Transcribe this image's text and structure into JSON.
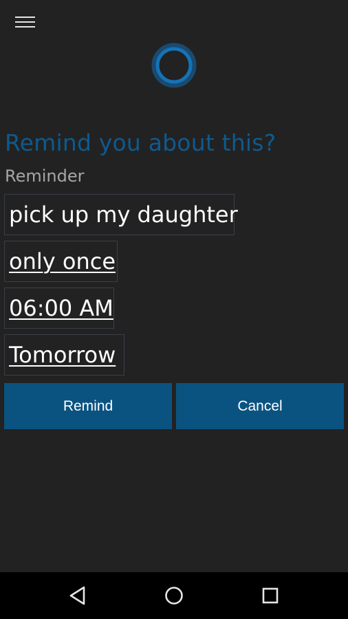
{
  "app": {
    "prompt": "Remind you about this?",
    "field_label": "Reminder"
  },
  "reminder": {
    "subject": "pick up my daughter",
    "frequency": "only once",
    "time": "06:00 AM",
    "day": "Tomorrow"
  },
  "actions": {
    "remind_label": "Remind",
    "cancel_label": "Cancel"
  },
  "icons": {
    "menu": "hamburger-menu-icon",
    "assistant": "cortana-ring-icon",
    "back": "back-triangle-icon",
    "home": "home-circle-icon",
    "recents": "recents-square-icon"
  },
  "colors": {
    "background": "#222222",
    "accent": "#0e5a8f",
    "button": "#0a5381",
    "navbar": "#000000"
  }
}
